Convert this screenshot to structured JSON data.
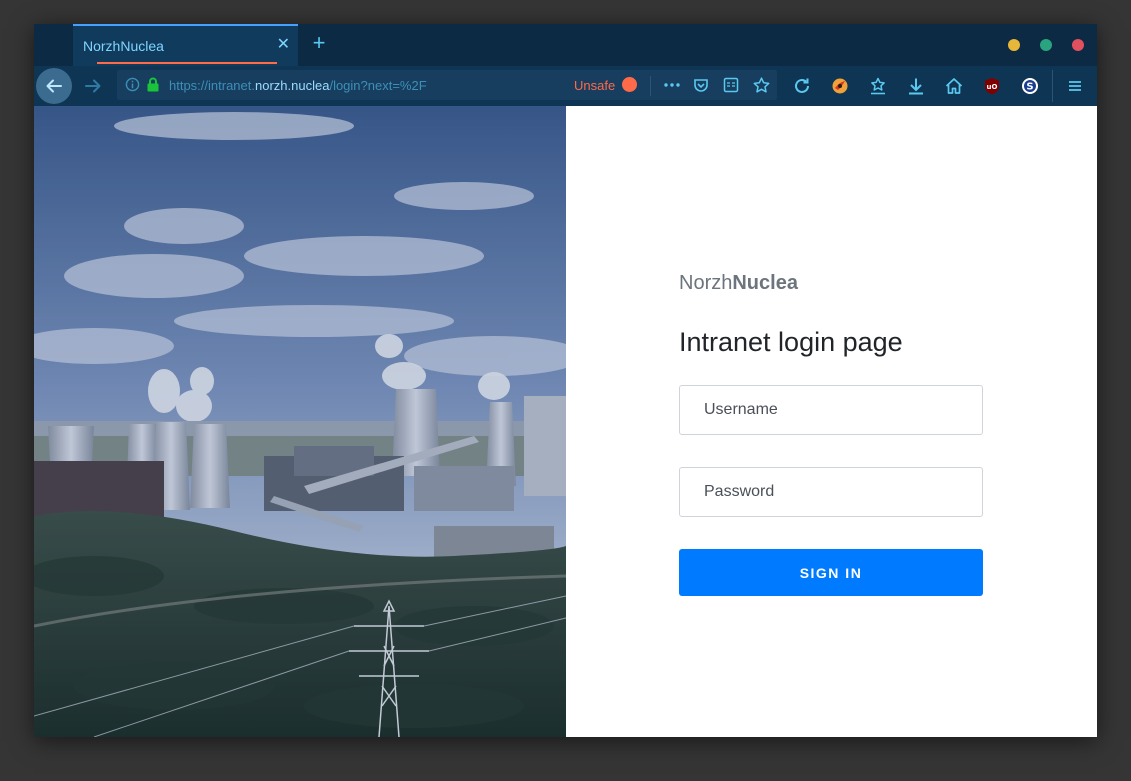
{
  "browser": {
    "tab_title": "NorzhNuclea",
    "url_prefix": "https://intranet.",
    "url_domain": "norzh.nuclea",
    "url_path": "/login?next=%2F",
    "security_label": "Unsafe"
  },
  "login": {
    "brand_light": "Norzh",
    "brand_bold": "Nuclea",
    "heading": "Intranet login page",
    "username_placeholder": "Username",
    "password_placeholder": "Password",
    "signin_label": "SIGN IN"
  },
  "colors": {
    "accent": "#007bff",
    "unsafe": "#ff6a49",
    "toolbar": "#0f3554"
  },
  "icons": [
    "back-arrow-icon",
    "forward-arrow-icon",
    "info-icon",
    "lock-icon",
    "more-icon",
    "pocket-icon",
    "reader-icon",
    "bookmark-star-icon",
    "reload-icon",
    "extension-icon",
    "bookmarks-icon",
    "download-icon",
    "home-icon",
    "ublock-icon",
    "s-extension-icon",
    "menu-icon"
  ]
}
